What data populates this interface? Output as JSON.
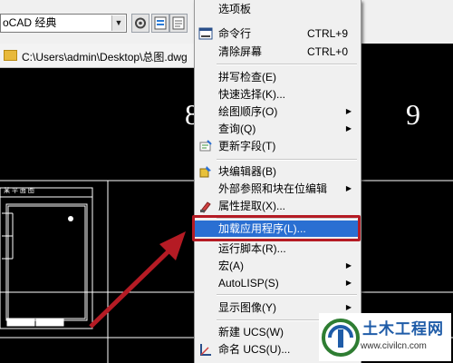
{
  "toolbar": {
    "workspace_value": "oCAD 经典"
  },
  "file_tab": {
    "path": "C:\\Users\\admin\\Desktop\\总图.dwg"
  },
  "canvas": {
    "left_number": "8",
    "right_number": "9",
    "title_block_text": "某 平 面 图"
  },
  "menu": {
    "items": [
      {
        "label": "选项板",
        "shortcut": "",
        "submenu": false,
        "icon": ""
      },
      {
        "label": "命令行",
        "shortcut": "CTRL+9",
        "submenu": false,
        "icon": "command-line-icon"
      },
      {
        "label": "清除屏幕",
        "shortcut": "CTRL+0",
        "submenu": false,
        "icon": ""
      },
      {
        "label": "拼写检查(E)",
        "shortcut": "",
        "submenu": false,
        "icon": ""
      },
      {
        "label": "快速选择(K)...",
        "shortcut": "",
        "submenu": false,
        "icon": ""
      },
      {
        "label": "绘图顺序(O)",
        "shortcut": "",
        "submenu": true,
        "icon": ""
      },
      {
        "label": "查询(Q)",
        "shortcut": "",
        "submenu": true,
        "icon": ""
      },
      {
        "label": "更新字段(T)",
        "shortcut": "",
        "submenu": false,
        "icon": "update-fields-icon"
      },
      {
        "label": "块编辑器(B)",
        "shortcut": "",
        "submenu": false,
        "icon": "block-editor-icon"
      },
      {
        "label": "外部参照和块在位编辑",
        "shortcut": "",
        "submenu": true,
        "icon": ""
      },
      {
        "label": "属性提取(X)...",
        "shortcut": "",
        "submenu": false,
        "icon": "attribute-extract-icon"
      },
      {
        "label": "加载应用程序(L)...",
        "shortcut": "",
        "submenu": false,
        "icon": ""
      },
      {
        "label": "运行脚本(R)...",
        "shortcut": "",
        "submenu": false,
        "icon": ""
      },
      {
        "label": "宏(A)",
        "shortcut": "",
        "submenu": true,
        "icon": ""
      },
      {
        "label": "AutoLISP(S)",
        "shortcut": "",
        "submenu": true,
        "icon": ""
      },
      {
        "label": "显示图像(Y)",
        "shortcut": "",
        "submenu": true,
        "icon": ""
      },
      {
        "label": "新建 UCS(W)",
        "shortcut": "",
        "submenu": true,
        "icon": ""
      },
      {
        "label": "命名 UCS(U)...",
        "shortcut": "",
        "submenu": false,
        "icon": "named-ucs-icon"
      }
    ],
    "highlighted_index": 11,
    "highlight_color": "#2a6fd2",
    "callout_color": "#b51b24"
  },
  "watermark": {
    "title": "土木工程网",
    "url": "www.civilcn.com"
  }
}
